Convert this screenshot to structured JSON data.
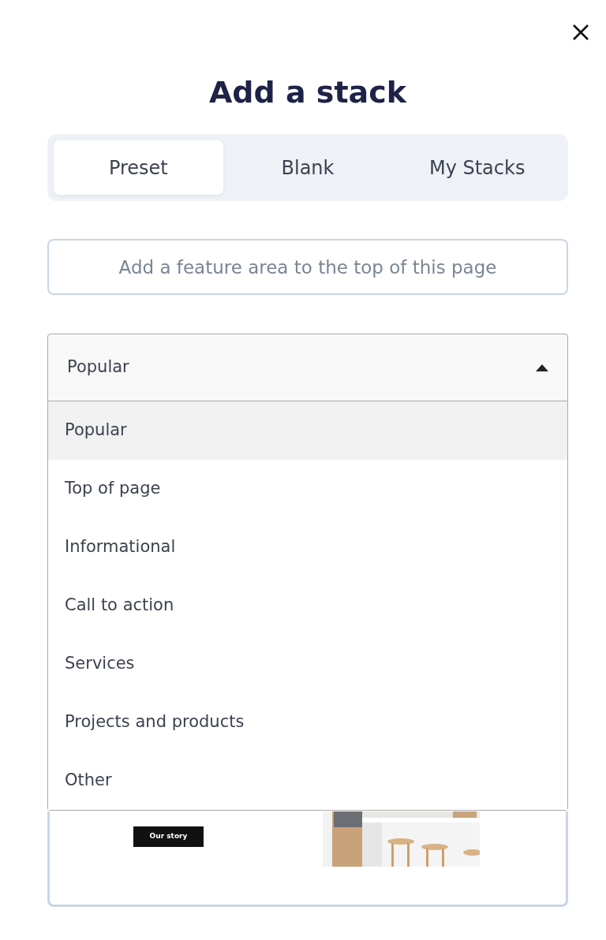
{
  "title": "Add a stack",
  "tabs": [
    {
      "label": "Preset",
      "selected": true
    },
    {
      "label": "Blank",
      "selected": false
    },
    {
      "label": "My Stacks",
      "selected": false
    }
  ],
  "search": {
    "placeholder": "Add a feature area to the top of this page"
  },
  "dropdown": {
    "value": "Popular",
    "expanded": true,
    "options": [
      {
        "label": "Popular",
        "selected": true
      },
      {
        "label": "Top of page",
        "selected": false
      },
      {
        "label": "Informational",
        "selected": false
      },
      {
        "label": "Call to action",
        "selected": false
      },
      {
        "label": "Services",
        "selected": false
      },
      {
        "label": "Projects and products",
        "selected": false
      },
      {
        "label": "Other",
        "selected": false
      }
    ]
  },
  "preview": {
    "button": "Our story"
  }
}
